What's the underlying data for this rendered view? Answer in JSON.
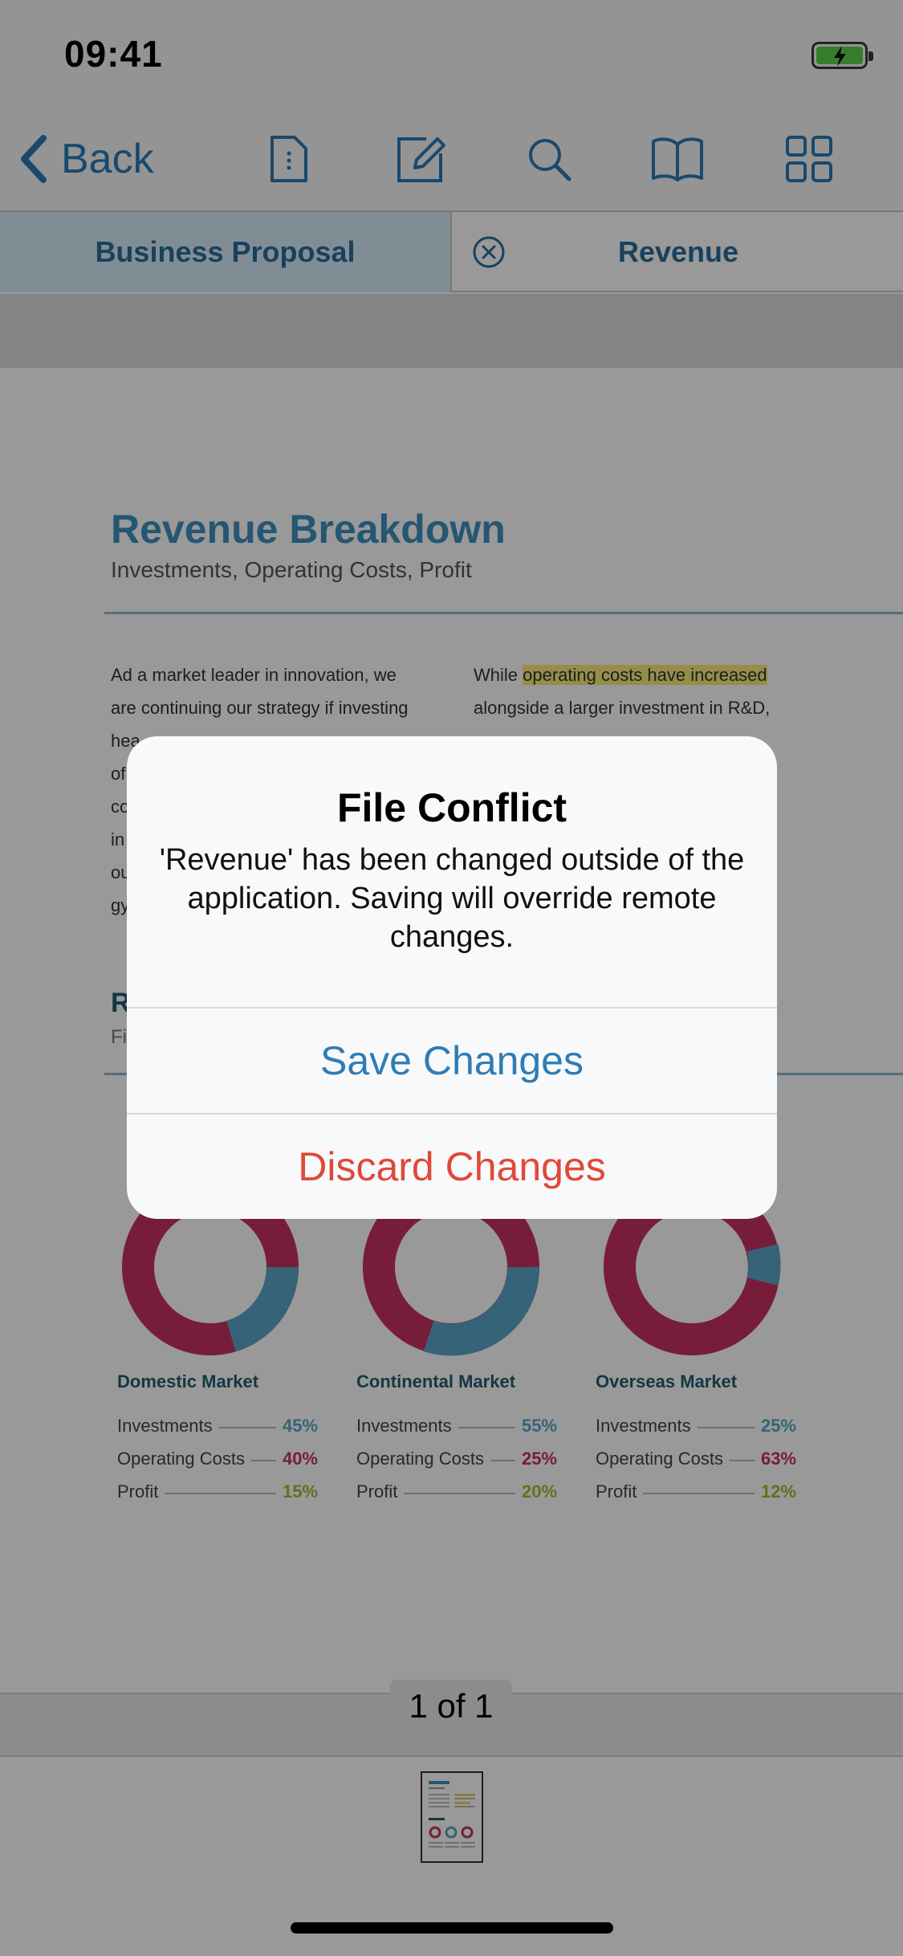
{
  "status_bar": {
    "time": "09:41"
  },
  "toolbar": {
    "back_label": "Back",
    "icons": [
      "document-icon",
      "edit-icon",
      "search-icon",
      "book-icon",
      "grid-icon"
    ]
  },
  "tabs": [
    {
      "label": "Business Proposal",
      "active": true
    },
    {
      "label": "Revenue",
      "active": false
    }
  ],
  "document": {
    "title": "Revenue Breakdown",
    "subtitle": "Investments, Operating Costs, Profit",
    "col1_lines": [
      "Ad a market leader in innovation, we",
      "are continuing our strategy if investing",
      "hea",
      "of",
      "co",
      "in",
      "ou",
      "gy"
    ],
    "col2_line1_prefix": "While ",
    "col2_line1_highlight": "operating costs have increased",
    "col2_lines": [
      "alongside a larger investment in R&D,"
    ],
    "section_title": "R",
    "section_subtitle": "Fi",
    "markets": [
      {
        "name": "Domestic Market",
        "rows": [
          {
            "label": "Investments",
            "value": "45%"
          },
          {
            "label": "Operating Costs",
            "value": "40%"
          },
          {
            "label": "Profit",
            "value": "15%"
          }
        ]
      },
      {
        "name": "Continental Market",
        "rows": [
          {
            "label": "Investments",
            "value": "55%"
          },
          {
            "label": "Operating Costs",
            "value": "25%"
          },
          {
            "label": "Profit",
            "value": "20%"
          }
        ]
      },
      {
        "name": "Overseas Market",
        "rows": [
          {
            "label": "Investments",
            "value": "25%"
          },
          {
            "label": "Operating Costs",
            "value": "63%"
          },
          {
            "label": "Profit",
            "value": "12%"
          }
        ]
      }
    ]
  },
  "pagination": {
    "label": "1 of 1"
  },
  "alert": {
    "title": "File Conflict",
    "message": "'Revenue' has been changed outside of the application. Saving will override remote changes.",
    "save_label": "Save Changes",
    "discard_label": "Discard Changes"
  },
  "colors": {
    "accent": "#2f7cb5",
    "destructive": "#e0483a",
    "investments": "#5aa6c8",
    "operating_costs": "#c8315f",
    "profit": "#a8b835",
    "overlay": "rgba(0,0,0,0.40)"
  }
}
